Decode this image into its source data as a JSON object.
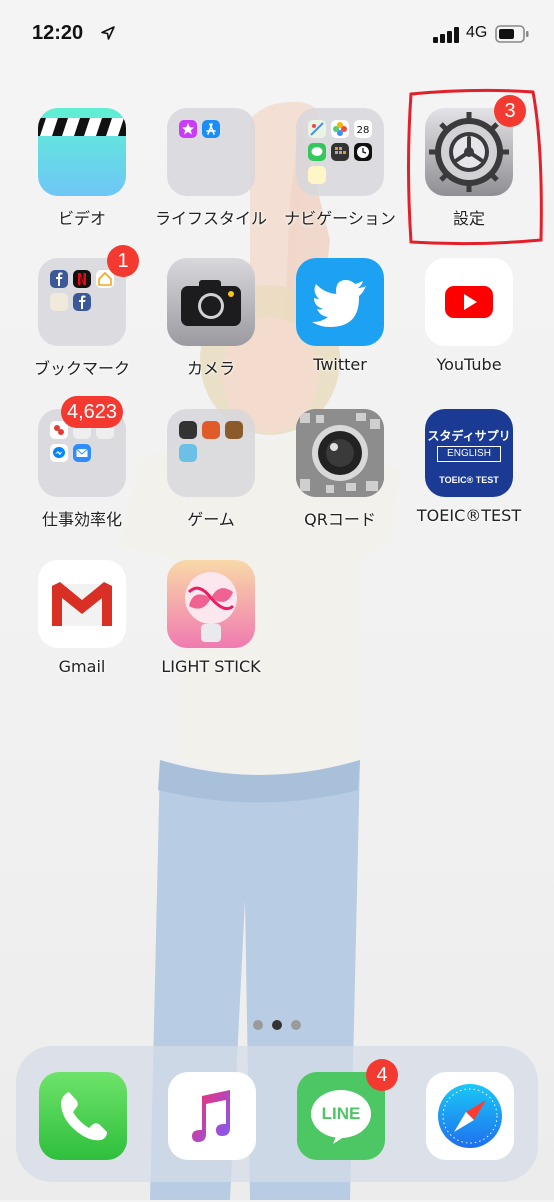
{
  "status_bar": {
    "time": "12:20",
    "network": "4G"
  },
  "home_screen": {
    "rows": [
      [
        {
          "label": "ビデオ",
          "icon": "videos-clapperboard-icon"
        },
        {
          "label": "ライフスタイル",
          "icon": "folder-icon"
        },
        {
          "label": "ナビゲーション",
          "icon": "folder-icon"
        },
        {
          "label": "設定",
          "icon": "settings-gear-icon",
          "badge": "3"
        }
      ],
      [
        {
          "label": "ブックマーク",
          "icon": "folder-icon",
          "badge": "1"
        },
        {
          "label": "カメラ",
          "icon": "camera-icon"
        },
        {
          "label": "Twitter",
          "icon": "twitter-bird-icon"
        },
        {
          "label": "YouTube",
          "icon": "youtube-play-icon"
        }
      ],
      [
        {
          "label": "仕事効率化",
          "icon": "folder-icon",
          "badge": "4,623"
        },
        {
          "label": "ゲーム",
          "icon": "folder-icon"
        },
        {
          "label": "QRコード",
          "icon": "qr-camera-icon"
        },
        {
          "label": "TOEIC®TEST",
          "icon": "studysapuri-icon"
        }
      ],
      [
        {
          "label": "Gmail",
          "icon": "gmail-icon"
        },
        {
          "label": "LIGHT STICK",
          "icon": "lightstick-icon"
        }
      ]
    ],
    "icon_texts": {
      "navigation_calendar_day": "28",
      "studysapuri_title": "スタディサプリ",
      "studysapuri_english": "ENGLISH",
      "studysapuri_test": "TOEIC® TEST",
      "line_logo": "LINE"
    },
    "page_dots": {
      "count": 3,
      "active": 2
    },
    "highlight_color": "#e3202a"
  },
  "dock": {
    "apps": [
      {
        "name": "phone",
        "icon": "phone-icon"
      },
      {
        "name": "music",
        "icon": "music-note-icon"
      },
      {
        "name": "line",
        "icon": "line-icon",
        "badge": "4"
      },
      {
        "name": "safari",
        "icon": "safari-compass-icon"
      }
    ]
  },
  "colors": {
    "badge": "#f43a30",
    "twitter": "#1da1f2",
    "youtube_red": "#ff0000",
    "line_green": "#4cc764",
    "studysapuri_blue": "#1a3a93"
  }
}
